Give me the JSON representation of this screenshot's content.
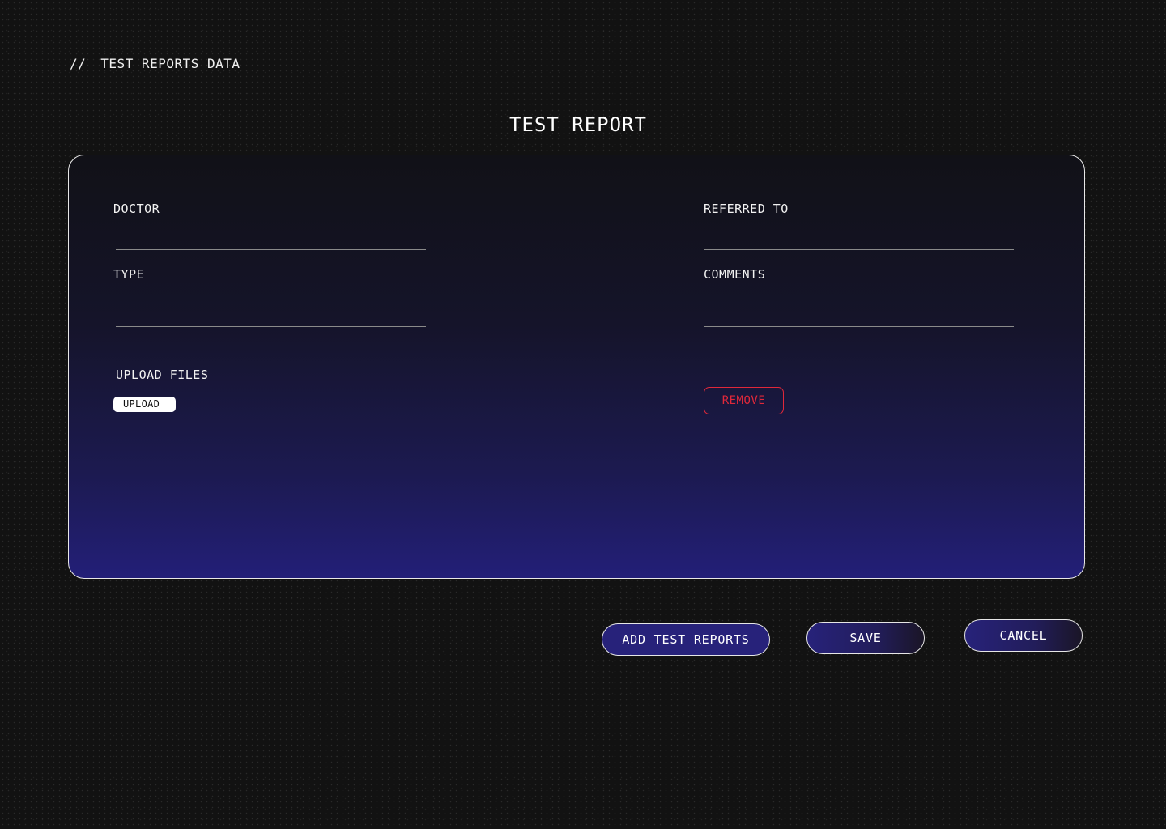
{
  "breadcrumb": {
    "prefix": "//",
    "label": "TEST REPORTS DATA"
  },
  "page_title": "TEST REPORT",
  "form": {
    "doctor_label": "DOCTOR",
    "doctor_value": "",
    "referred_label": "REFERRED TO",
    "referred_value": "",
    "type_label": "TYPE",
    "type_value": "",
    "comments_label": "COMMENTS",
    "comments_value": "",
    "upload_files_label": "UPLOAD FILES",
    "upload_button": "UPLOAD",
    "remove_button": "REMOVE"
  },
  "actions": {
    "add_label": "ADD TEST REPORTS",
    "save_label": "SAVE",
    "cancel_label": "CANCEL"
  },
  "colors": {
    "background": "#121212",
    "card_gradient_bottom": "#231f78",
    "button_fill": "#27227a",
    "remove": "#e0283a"
  }
}
